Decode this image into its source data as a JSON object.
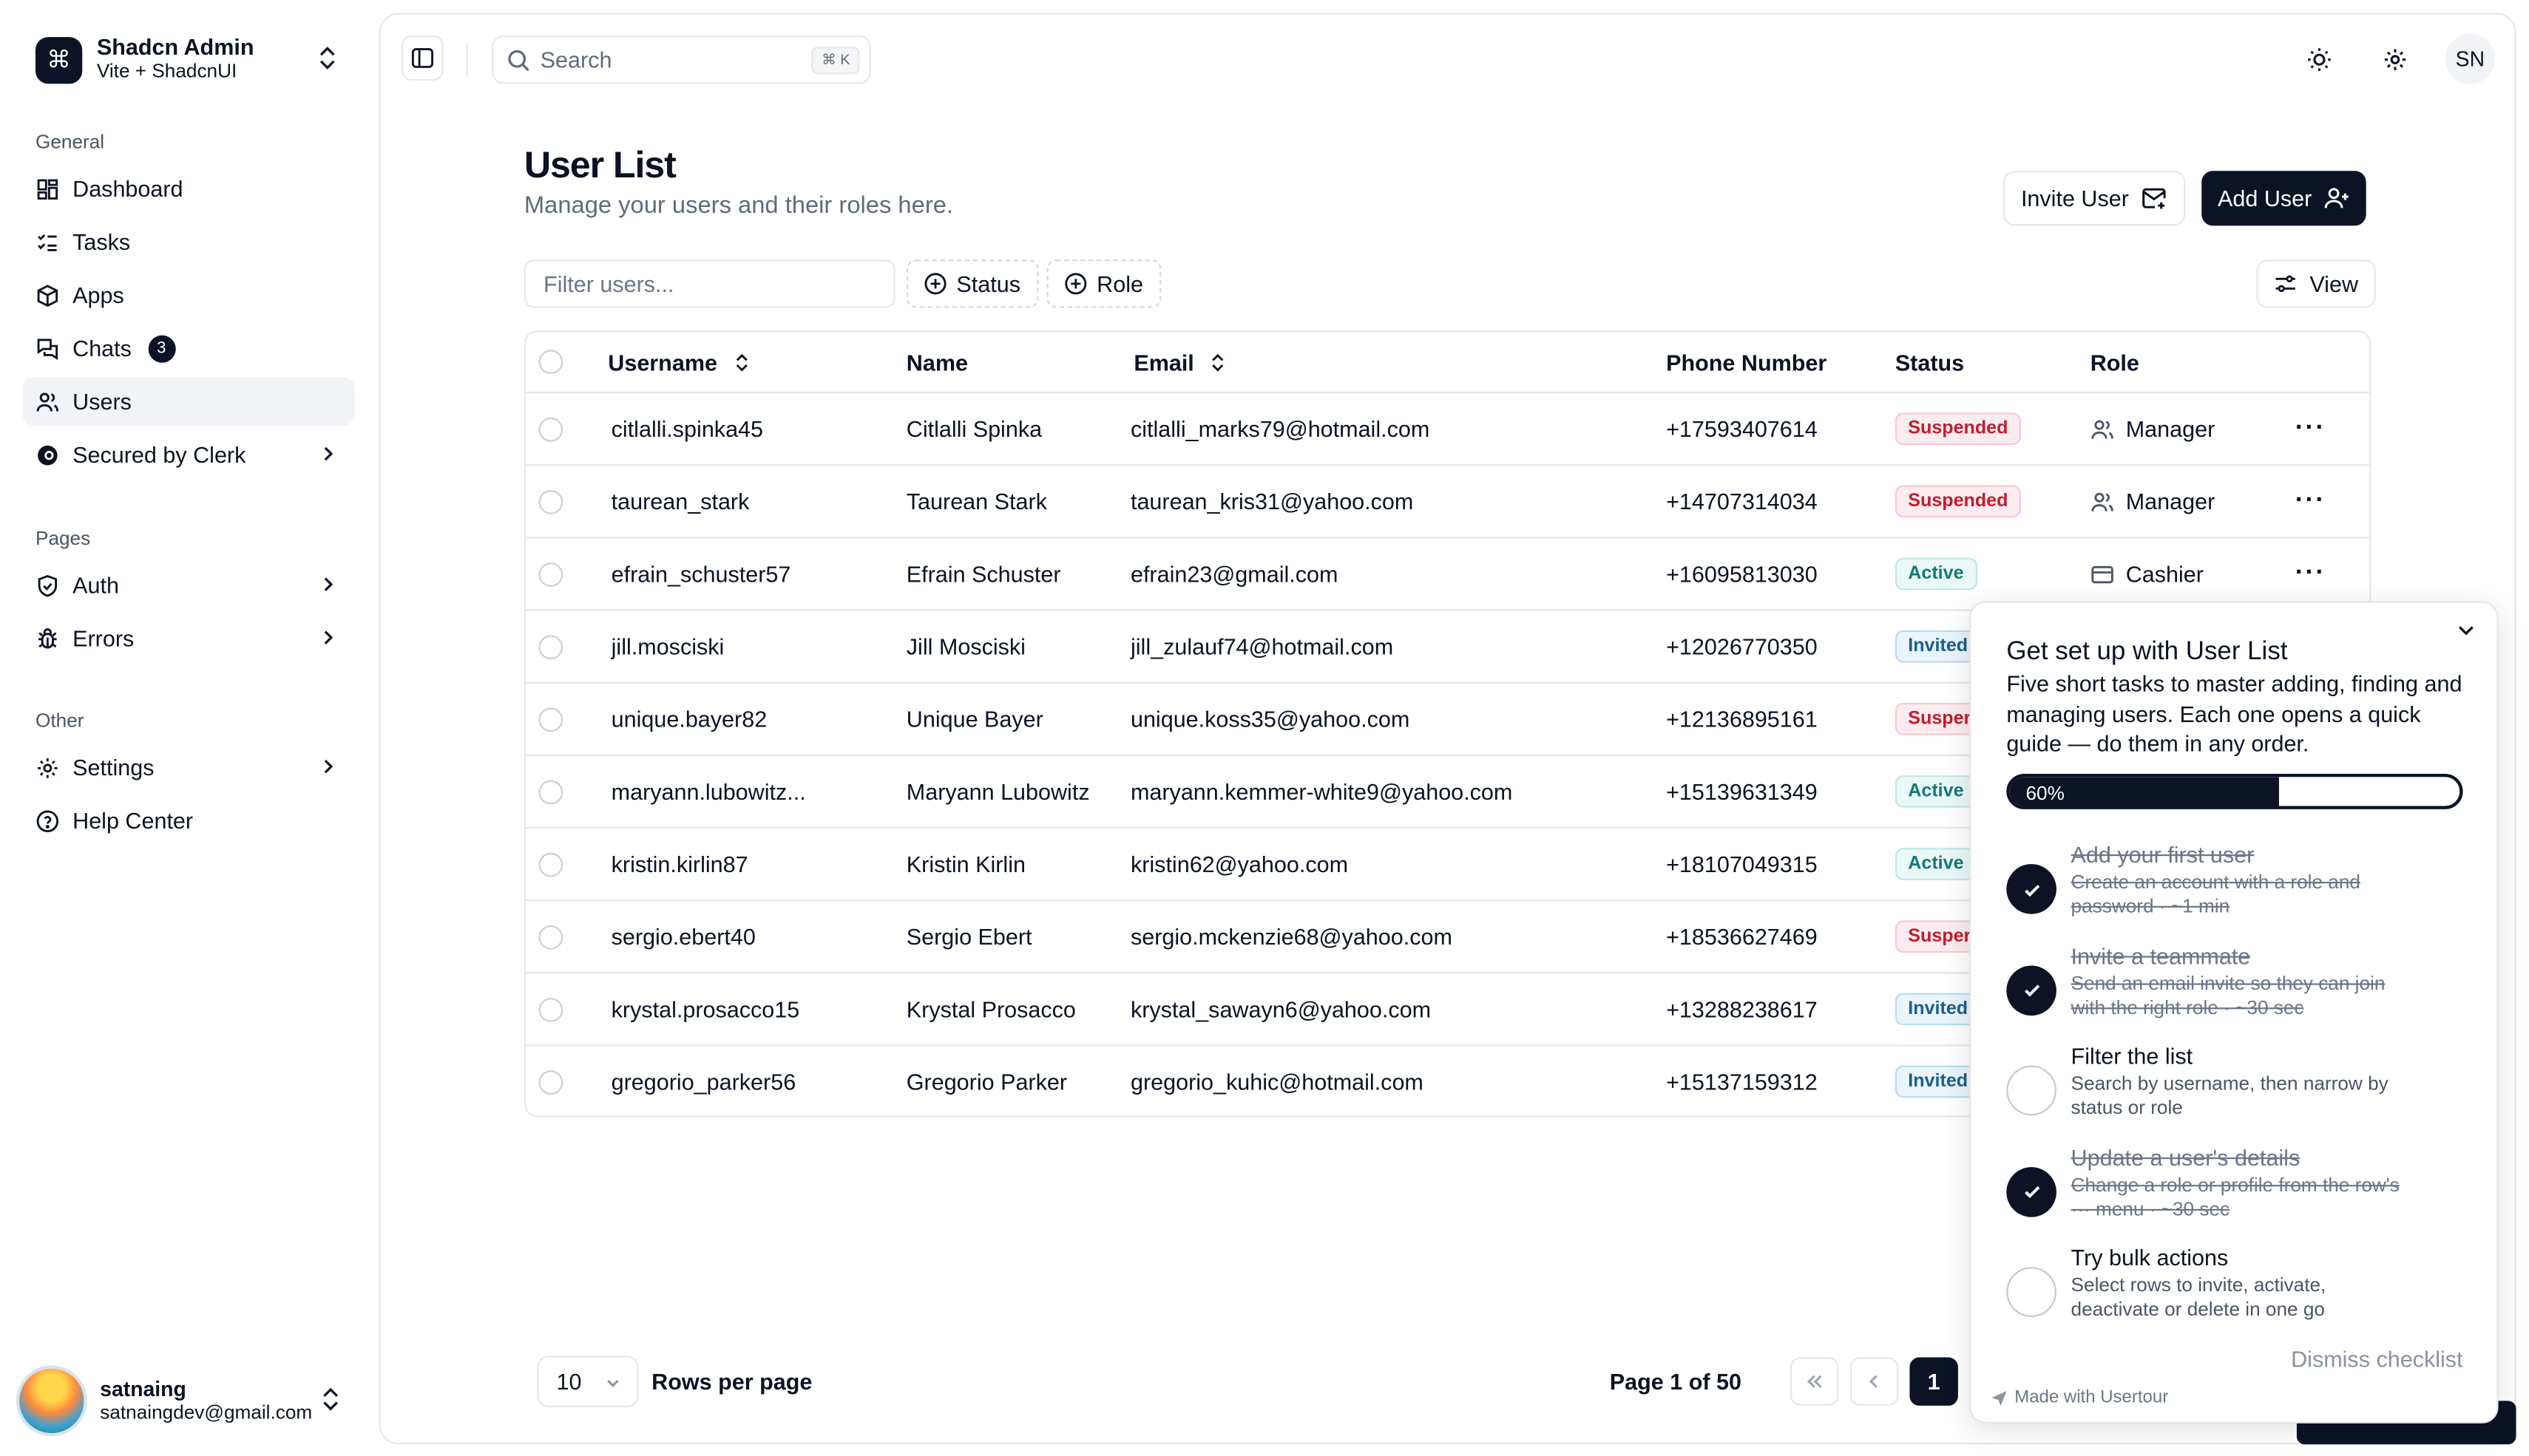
{
  "app": {
    "name": "Shadcn Admin",
    "subtitle": "Vite + ShadcnUI"
  },
  "sidebar": {
    "groups": {
      "general": "General",
      "pages": "Pages",
      "other": "Other"
    },
    "items": [
      {
        "label": "Dashboard"
      },
      {
        "label": "Tasks"
      },
      {
        "label": "Apps"
      },
      {
        "label": "Chats",
        "badge": "3"
      },
      {
        "label": "Users"
      },
      {
        "label": "Secured by Clerk"
      },
      {
        "label": "Auth"
      },
      {
        "label": "Errors"
      },
      {
        "label": "Settings"
      },
      {
        "label": "Help Center"
      }
    ],
    "user": {
      "name": "satnaing",
      "email": "satnaingdev@gmail.com"
    }
  },
  "header": {
    "search_placeholder": "Search",
    "search_shortcut": "⌘ K",
    "avatar_initials": "SN"
  },
  "page": {
    "title": "User List",
    "subtitle": "Manage your users and their roles here."
  },
  "actions": {
    "invite": "Invite User",
    "add": "Add User"
  },
  "filters": {
    "placeholder": "Filter users...",
    "status": "Status",
    "role": "Role",
    "view": "View"
  },
  "table": {
    "headers": {
      "username": "Username",
      "name": "Name",
      "email": "Email",
      "phone": "Phone Number",
      "status": "Status",
      "role": "Role"
    },
    "rows": [
      {
        "username": "citlalli.spinka45",
        "name": "Citlalli Spinka",
        "email": "citlalli_marks79@hotmail.com",
        "phone": "+17593407614",
        "status": "Suspended",
        "role": "Manager"
      },
      {
        "username": "taurean_stark",
        "name": "Taurean Stark",
        "email": "taurean_kris31@yahoo.com",
        "phone": "+14707314034",
        "status": "Suspended",
        "role": "Manager"
      },
      {
        "username": "efrain_schuster57",
        "name": "Efrain Schuster",
        "email": "efrain23@gmail.com",
        "phone": "+16095813030",
        "status": "Active",
        "role": "Cashier"
      },
      {
        "username": "jill.mosciski",
        "name": "Jill Mosciski",
        "email": "jill_zulauf74@hotmail.com",
        "phone": "+12026770350",
        "status": "Invited",
        "role": ""
      },
      {
        "username": "unique.bayer82",
        "name": "Unique Bayer",
        "email": "unique.koss35@yahoo.com",
        "phone": "+12136895161",
        "status": "Susper",
        "role": ""
      },
      {
        "username": "maryann.lubowitz...",
        "name": "Maryann Lubowitz",
        "email": "maryann.kemmer-white9@yahoo.com",
        "phone": "+15139631349",
        "status": "Active",
        "role": ""
      },
      {
        "username": "kristin.kirlin87",
        "name": "Kristin Kirlin",
        "email": "kristin62@yahoo.com",
        "phone": "+18107049315",
        "status": "Active",
        "role": ""
      },
      {
        "username": "sergio.ebert40",
        "name": "Sergio Ebert",
        "email": "sergio.mckenzie68@yahoo.com",
        "phone": "+18536627469",
        "status": "Susper",
        "role": ""
      },
      {
        "username": "krystal.prosacco15",
        "name": "Krystal Prosacco",
        "email": "krystal_sawayn6@yahoo.com",
        "phone": "+13288238617",
        "status": "Invited",
        "role": ""
      },
      {
        "username": "gregorio_parker56",
        "name": "Gregorio Parker",
        "email": "gregorio_kuhic@hotmail.com",
        "phone": "+15137159312",
        "status": "Invited",
        "role": ""
      }
    ]
  },
  "pagination": {
    "page_size": "10",
    "rows_label": "Rows per page",
    "page_info": "Page 1 of 50",
    "current_page": "1"
  },
  "checklist": {
    "title": "Get set up with User List",
    "description": "Five short tasks to master adding, finding and managing users. Each one opens a quick guide — do them in any order.",
    "progress": 60,
    "progress_label": "60%",
    "tasks": [
      {
        "title": "Add your first user",
        "desc": "Create an account with a role and password · ~1 min",
        "done": true
      },
      {
        "title": "Invite a teammate",
        "desc": "Send an email invite so they can join with the right role · ~30 sec",
        "done": true
      },
      {
        "title": "Filter the list",
        "desc": "Search by username, then narrow by status or role",
        "done": false
      },
      {
        "title": "Update a user's details",
        "desc": "Change a role or profile from the row's ··· menu · ~30 sec",
        "done": true
      },
      {
        "title": "Try bulk actions",
        "desc": "Select rows to invite, activate, deactivate or delete in one go",
        "done": false
      }
    ],
    "dismiss": "Dismiss checklist",
    "made_with": "Made with Usertour"
  },
  "colors": {
    "primary": "#0b1324",
    "suspended": "#c31c2d",
    "active": "#137a73",
    "invited": "#1b5f8b"
  }
}
